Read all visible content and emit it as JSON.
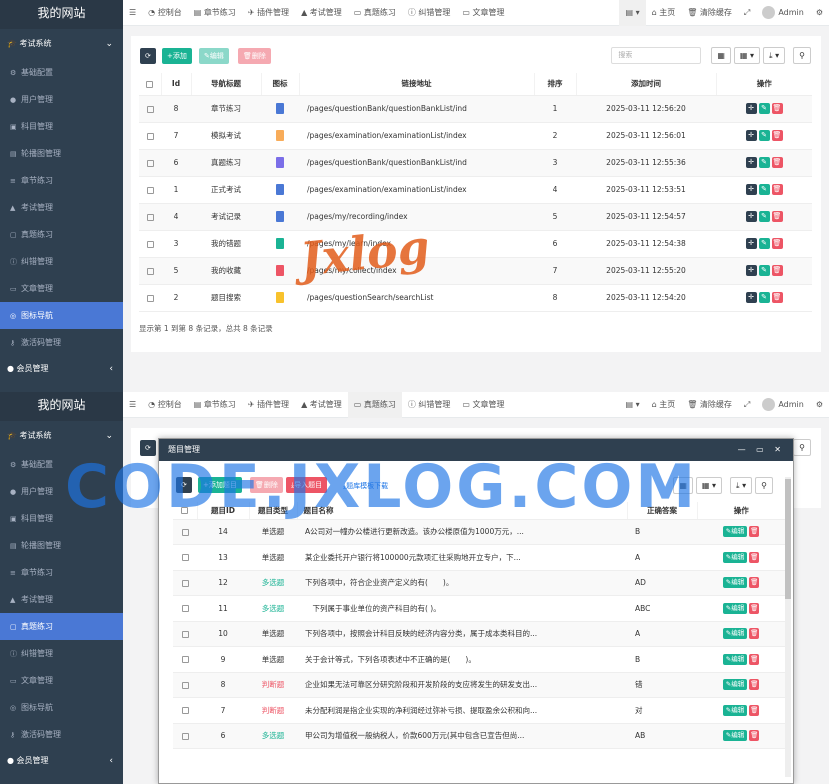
{
  "site_name": "我的网站",
  "sidebar": {
    "group": "考试系统",
    "items": [
      {
        "label": "基础配置",
        "icon": "gear-icon"
      },
      {
        "label": "用户管理",
        "icon": "user-icon"
      },
      {
        "label": "科目管理",
        "icon": "book-icon"
      },
      {
        "label": "轮播图管理",
        "icon": "image-icon"
      },
      {
        "label": "章节练习",
        "icon": "list-icon"
      },
      {
        "label": "考试管理",
        "icon": "graduation-icon"
      },
      {
        "label": "真题练习",
        "icon": "file-icon"
      },
      {
        "label": "纠错管理",
        "icon": "info-icon"
      },
      {
        "label": "文章管理",
        "icon": "doc-icon"
      },
      {
        "label": "图标导航",
        "icon": "compass-icon"
      },
      {
        "label": "激活码管理",
        "icon": "key-icon"
      }
    ],
    "bottom": "会员管理"
  },
  "topnav": [
    "控制台",
    "章节练习",
    "插件管理",
    "考试管理",
    "真题练习",
    "纠错管理",
    "文章管理"
  ],
  "topright": {
    "home": "主页",
    "clear": "清除缓存",
    "user": "Admin"
  },
  "toolbar": {
    "add": "添加",
    "edit": "编辑",
    "delete": "删除",
    "search_placeholder": "搜索"
  },
  "nav_table": {
    "headers": [
      "Id",
      "导航标题",
      "图标",
      "链接地址",
      "排序",
      "添加时间",
      "操作"
    ],
    "rows": [
      {
        "id": "8",
        "title": "章节练习",
        "color": "#4a78d5",
        "url": "/pages/questionBank/questionBankList/ind",
        "sort": "1",
        "time": "2025-03-11 12:56:20"
      },
      {
        "id": "7",
        "title": "模拟考试",
        "color": "#f8ac59",
        "url": "/pages/examination/examinationList/index",
        "sort": "2",
        "time": "2025-03-11 12:56:01"
      },
      {
        "id": "6",
        "title": "真题练习",
        "color": "#7b6ee8",
        "url": "/pages/questionBank/questionBankList/ind",
        "sort": "3",
        "time": "2025-03-11 12:55:36"
      },
      {
        "id": "1",
        "title": "正式考试",
        "color": "#4a78d5",
        "url": "/pages/examination/examinationList/index",
        "sort": "4",
        "time": "2025-03-11 12:53:51"
      },
      {
        "id": "4",
        "title": "考试记录",
        "color": "#4a78d5",
        "url": "/pages/my/recording/index",
        "sort": "5",
        "time": "2025-03-11 12:54:57"
      },
      {
        "id": "3",
        "title": "我的错题",
        "color": "#1ab394",
        "url": "/pages/my/learn/index",
        "sort": "6",
        "time": "2025-03-11 12:54:38"
      },
      {
        "id": "5",
        "title": "我的收藏",
        "color": "#ed5565",
        "url": "/pages/my/collect/index",
        "sort": "7",
        "time": "2025-03-11 12:55:20"
      },
      {
        "id": "2",
        "title": "题目搜索",
        "color": "#f8c22c",
        "url": "/pages/questionSearch/searchList",
        "sort": "8",
        "time": "2025-03-11 12:54:20"
      }
    ]
  },
  "footer_text": "显示第 1 到第 8 条记录，总共 8 条记录",
  "watermark1": "Jxlog",
  "watermark2": "CODE.JXLOG.COM",
  "modal": {
    "title": "题目管理",
    "add": "添加题目",
    "delete": "删除",
    "import": "导入题目",
    "download": "题库模板下载",
    "headers": [
      "题目ID",
      "题目类型",
      "题目名称",
      "正确答案",
      "操作"
    ],
    "edit": "编辑",
    "rows": [
      {
        "id": "14",
        "type": "单选题",
        "cls": "",
        "name": "A公司对一幢办公楼进行更新改造。该办公楼原值为1000万元，...",
        "ans": "B"
      },
      {
        "id": "13",
        "type": "单选题",
        "cls": "",
        "name": "某企业委托开户银行将100000元款项汇往采购地开立专户，下...",
        "ans": "A"
      },
      {
        "id": "12",
        "type": "多选题",
        "cls": "tg",
        "name": "下列各项中，符合企业资产定义的有(　　)。",
        "ans": "AD"
      },
      {
        "id": "11",
        "type": "多选题",
        "cls": "tg",
        "name": "　下列属于事业单位的资产科目的有( )。",
        "ans": "ABC"
      },
      {
        "id": "10",
        "type": "单选题",
        "cls": "",
        "name": "下列各项中，按照会计科目反映的经济内容分类，属于成本类科目的...",
        "ans": "A"
      },
      {
        "id": "9",
        "type": "单选题",
        "cls": "",
        "name": "关于会计等式，下列各项表述中不正确的是(　　)。",
        "ans": "B"
      },
      {
        "id": "8",
        "type": "判断题",
        "cls": "tr",
        "name": "企业如果无法可靠区分研究阶段和开发阶段的支应将发生的研发支出...",
        "ans": "错"
      },
      {
        "id": "7",
        "type": "判断题",
        "cls": "tr",
        "name": "未分配利润是指企业实现的净利润经过弥补亏损、提取盈余公积和向...",
        "ans": "对"
      },
      {
        "id": "6",
        "type": "多选题",
        "cls": "tg",
        "name": "甲公司为增值税一般纳税人，价款600万元(其中包含已宣告但尚...",
        "ans": "AB"
      }
    ]
  }
}
